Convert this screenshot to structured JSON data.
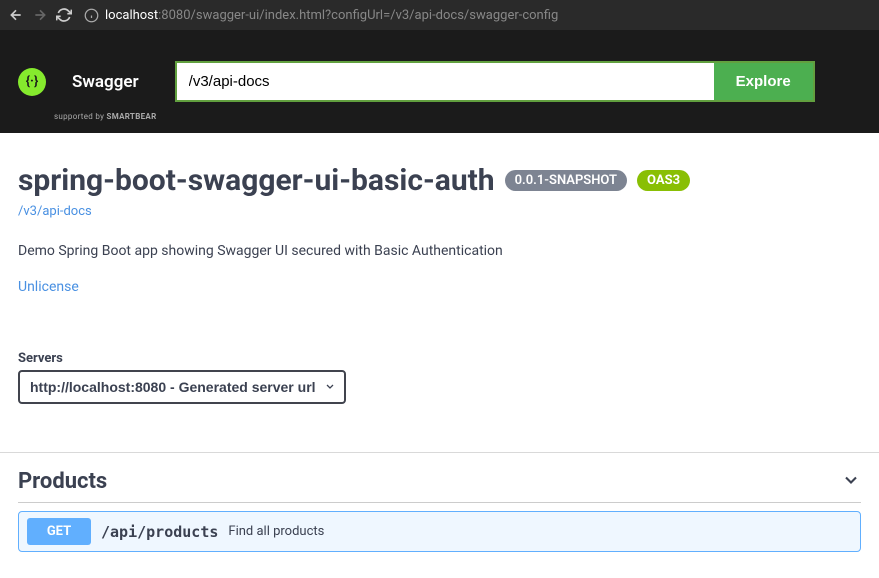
{
  "browser": {
    "url_host": "localhost",
    "url_rest": ":8080/swagger-ui/index.html?configUrl=/v3/api-docs/swagger-config"
  },
  "topbar": {
    "logo_main": "Swagger",
    "logo_sub_prefix": "supported by ",
    "logo_sub_brand": "SMARTBEAR",
    "input_value": "/v3/api-docs",
    "explore_label": "Explore"
  },
  "info": {
    "title": "spring-boot-swagger-ui-basic-auth",
    "version": "0.0.1-SNAPSHOT",
    "oas": "OAS3",
    "docs_link": "/v3/api-docs",
    "description": "Demo Spring Boot app showing Swagger UI secured with Basic Authentication",
    "license": "Unlicense"
  },
  "servers": {
    "label": "Servers",
    "selected": "http://localhost:8080 - Generated server url"
  },
  "tags": [
    {
      "name": "Products",
      "operations": [
        {
          "method": "GET",
          "path": "/api/products",
          "summary": "Find all products"
        }
      ]
    }
  ]
}
